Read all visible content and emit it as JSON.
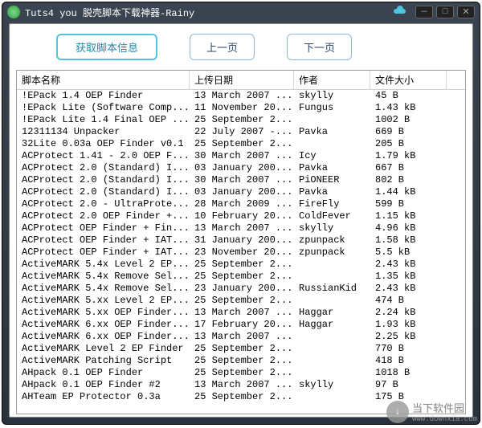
{
  "window": {
    "title": "Tuts4 you 脱壳脚本下载神器-Rainy"
  },
  "toolbar": {
    "fetch_info_label": "获取脚本信息",
    "prev_page_label": "上一页",
    "next_page_label": "下一页"
  },
  "columns": {
    "name": "脚本名称",
    "upload_date": "上传日期",
    "author": "作者",
    "size": "文件大小"
  },
  "rows": [
    {
      "name": "!EPack 1.4 OEP Finder",
      "date": "13 March 2007 ...",
      "author": "skylly",
      "size": "45 B"
    },
    {
      "name": "!EPack Lite (Software Comp...",
      "date": "11 November 20...",
      "author": "Fungus",
      "size": "1.43 kB"
    },
    {
      "name": "!EPack Lite 1.4 Final OEP ...",
      "date": "25 September 2...",
      "author": "",
      "size": "1002 B"
    },
    {
      "name": "12311134 Unpacker",
      "date": "22 July 2007 -...",
      "author": "Pavka",
      "size": "669 B"
    },
    {
      "name": "32Lite 0.03a OEP Finder v0.1",
      "date": "25 September 2...",
      "author": "",
      "size": "205 B"
    },
    {
      "name": "ACProtect 1.41 - 2.0 OEP F...",
      "date": "30 March 2007 ...",
      "author": "Icy",
      "size": "1.79 kB"
    },
    {
      "name": "ACProtect 2.0 (Standard) I...",
      "date": "03 January 200...",
      "author": "Pavka",
      "size": "667 B"
    },
    {
      "name": "ACProtect 2.0 (Standard) I...",
      "date": "30 March 2007 ...",
      "author": "PiONEER",
      "size": "802 B"
    },
    {
      "name": "ACProtect 2.0 (Standard) I...",
      "date": "03 January 200...",
      "author": "Pavka",
      "size": "1.44 kB"
    },
    {
      "name": "ACProtect 2.0 - UltraProte...",
      "date": "28 March 2009 ...",
      "author": "FireFly",
      "size": "599 B"
    },
    {
      "name": "ACProtect 2.0 OEP Finder +...",
      "date": "10 February 20...",
      "author": "ColdFever",
      "size": "1.15 kB"
    },
    {
      "name": "ACProtect OEP Finder + Fin...",
      "date": "13 March 2007 ...",
      "author": "skylly",
      "size": "4.96 kB"
    },
    {
      "name": "ACProtect OEP Finder + IAT...",
      "date": "31 January 200...",
      "author": "zpunpack",
      "size": "1.58 kB"
    },
    {
      "name": "ACProtect OEP Finder + IAT...",
      "date": "23 November 20...",
      "author": "zpunpack",
      "size": "5.5 kB"
    },
    {
      "name": "ActiveMARK 5.4x Level 2 EP...",
      "date": "25 September 2...",
      "author": "",
      "size": "2.43 kB"
    },
    {
      "name": "ActiveMARK 5.4x Remove Sel...",
      "date": "25 September 2...",
      "author": "",
      "size": "1.35 kB"
    },
    {
      "name": "ActiveMARK 5.4x Remove Sel...",
      "date": "23 January 200...",
      "author": "RussianKid",
      "size": "2.43 kB"
    },
    {
      "name": "ActiveMARK 5.xx Level 2 EP...",
      "date": "25 September 2...",
      "author": "",
      "size": "474 B"
    },
    {
      "name": "ActiveMARK 5.xx OEP Finder...",
      "date": "13 March 2007 ...",
      "author": "Haggar",
      "size": "2.24 kB"
    },
    {
      "name": "ActiveMARK 6.xx OEP Finder...",
      "date": "17 February 20...",
      "author": "Haggar",
      "size": "1.93 kB"
    },
    {
      "name": "ActiveMARK 6.xx OEP Finder...",
      "date": "13 March 2007 ...",
      "author": "",
      "size": "2.25 kB"
    },
    {
      "name": "ActiveMARK Level 2 EP Finder",
      "date": "25 September 2...",
      "author": "",
      "size": "770 B"
    },
    {
      "name": "ActiveMARK Patching Script",
      "date": "25 September 2...",
      "author": "",
      "size": "418 B"
    },
    {
      "name": "AHpack 0.1 OEP Finder",
      "date": "25 September 2...",
      "author": "",
      "size": "1018 B"
    },
    {
      "name": "AHpack 0.1 OEP Finder #2",
      "date": "13 March 2007 ...",
      "author": "skylly",
      "size": "97 B"
    },
    {
      "name": "AHTeam EP Protector 0.3a",
      "date": "25 September 2...",
      "author": "",
      "size": "175 B"
    }
  ],
  "watermark": {
    "line1": "当下软件园",
    "line2": "www.downxia.com",
    "arrow": "↓"
  }
}
